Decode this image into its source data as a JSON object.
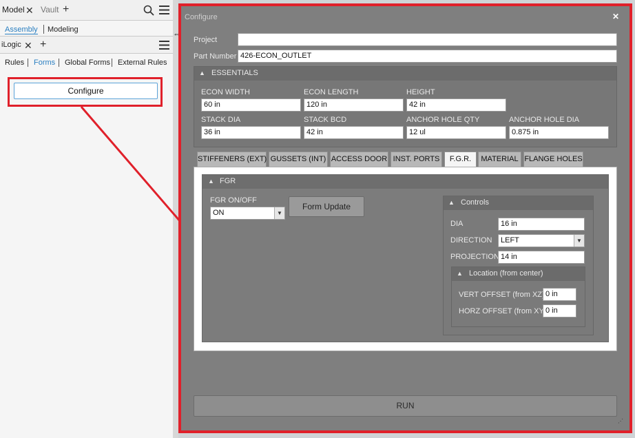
{
  "left": {
    "tab_model": "Model",
    "tab_vault": "Vault",
    "subtab_assembly": "Assembly",
    "subtab_modeling": "Modeling",
    "tab_ilogic": "iLogic",
    "nav_rules": "Rules",
    "nav_forms": "Forms",
    "nav_global_forms": "Global Forms",
    "nav_external_rules": "External Rules",
    "configure_button": "Configure"
  },
  "dialog": {
    "title": "Configure",
    "project_label": "Project",
    "project_value": "",
    "part_number_label": "Part Number",
    "part_number_value": "426-ECON_OUTLET",
    "essentials": {
      "title": "ESSENTIALS",
      "econ_width_label": "ECON WIDTH",
      "econ_width_value": "60 in",
      "econ_length_label": "ECON LENGTH",
      "econ_length_value": "120 in",
      "height_label": "HEIGHT",
      "height_value": "42 in",
      "stack_dia_label": "STACK DIA",
      "stack_dia_value": "36 in",
      "stack_bcd_label": "STACK BCD",
      "stack_bcd_value": "42 in",
      "anchor_hole_qty_label": "ANCHOR HOLE QTY",
      "anchor_hole_qty_value": "12 ul",
      "anchor_hole_dia_label": "ANCHOR HOLE DIA",
      "anchor_hole_dia_value": "0.875 in"
    },
    "tabs": [
      "STIFFENERS (EXT)",
      "GUSSETS (INT)",
      "ACCESS DOOR",
      "INST. PORTS",
      "F.G.R.",
      "MATERIAL",
      "FLANGE HOLES"
    ],
    "active_tab": "F.G.R.",
    "fgr": {
      "title": "FGR",
      "onoff_label": "FGR ON/OFF",
      "onoff_value": "ON",
      "form_update_button": "Form Update",
      "controls": {
        "title": "Controls",
        "dia_label": "DIA",
        "dia_value": "16 in",
        "direction_label": "DIRECTION",
        "direction_value": "LEFT",
        "projection_label": "PROJECTION",
        "projection_value": "14 in",
        "location": {
          "title": "Location (from center)",
          "vert_offset_label": "VERT OFFSET (from XZ)",
          "vert_offset_value": "0 in",
          "horz_offset_label": "HORZ OFFSET (from XY)",
          "horz_offset_value": "0 in"
        }
      }
    },
    "run_button": "RUN"
  },
  "colors": {
    "highlight_red": "#e0202a",
    "link_blue": "#2a7fc1",
    "dialog_gray": "#7f7f7f"
  },
  "icons": [
    "close-icon",
    "add-icon",
    "search-icon",
    "hamburger-menu-icon",
    "resize-cursor-icon",
    "chevron-up-icon",
    "dropdown-arrow-icon",
    "resize-grip-icon"
  ]
}
